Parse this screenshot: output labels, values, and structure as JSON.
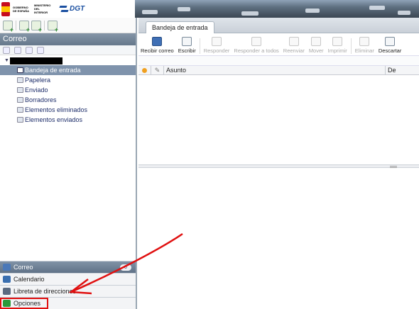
{
  "banner": {
    "gobierno_text": "GOBIERNO DE ESPAÑA",
    "ministerio_text": "MINISTERIO DEL INTERIOR",
    "dgt_text": "DGT"
  },
  "left_panel": {
    "header": "Correo",
    "folders": [
      {
        "label": "Bandeja de entrada",
        "selected": true,
        "icon": "inbox-icon"
      },
      {
        "label": "Papelera",
        "selected": false,
        "icon": "trash-folder-icon"
      },
      {
        "label": "Enviado",
        "selected": false,
        "icon": "sent-folder-icon"
      },
      {
        "label": "Borradores",
        "selected": false,
        "icon": "drafts-folder-icon"
      },
      {
        "label": "Elementos eliminados",
        "selected": false,
        "icon": "folder-icon"
      },
      {
        "label": "Elementos enviados",
        "selected": false,
        "icon": "folder-icon"
      }
    ],
    "nav": [
      {
        "label": "Correo",
        "badge": "0",
        "active": true,
        "icon": "mail-icon"
      },
      {
        "label": "Calendario",
        "active": false,
        "icon": "calendar-icon"
      },
      {
        "label": "Libreta de direcciones",
        "active": false,
        "icon": "address-book-icon"
      },
      {
        "label": "Opciones",
        "active": false,
        "icon": "checkmark-icon"
      }
    ]
  },
  "right_panel": {
    "tab": "Bandeja de entrada",
    "toolbar": [
      {
        "label": "Recibir correo",
        "enabled": true
      },
      {
        "label": "Escribir",
        "enabled": true
      },
      {
        "label": "Responder",
        "enabled": false
      },
      {
        "label": "Responder a todos",
        "enabled": false
      },
      {
        "label": "Reenviar",
        "enabled": false
      },
      {
        "label": "Mover",
        "enabled": false
      },
      {
        "label": "Imprimir",
        "enabled": false
      },
      {
        "label": "Eliminar",
        "enabled": false
      },
      {
        "label": "Descartar",
        "enabled": true
      }
    ],
    "columns": {
      "subject": "Asunto",
      "from": "De"
    }
  },
  "colors": {
    "selection": "#7f93ac",
    "annotation": "#e01010",
    "header_gradient_top": "#8495a7"
  }
}
